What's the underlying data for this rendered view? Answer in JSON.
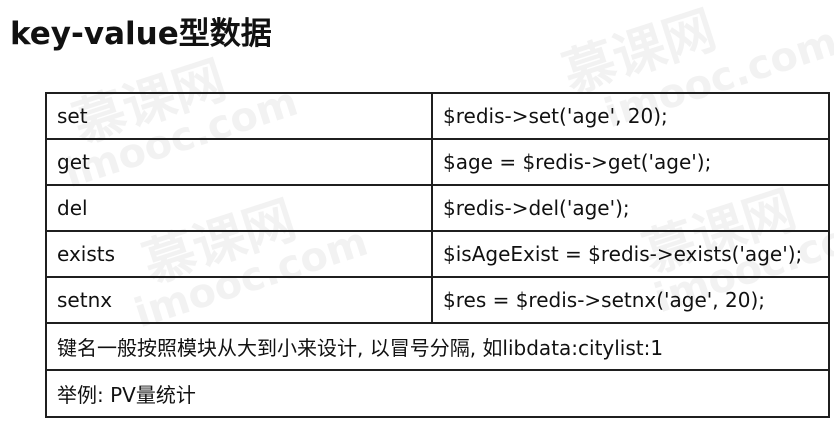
{
  "page": {
    "title": "key-value型数据"
  },
  "table": {
    "rows": [
      {
        "command": "set",
        "code": "$redis->set('age', 20);"
      },
      {
        "command": "get",
        "code": "$age = $redis->get('age');"
      },
      {
        "command": "del",
        "code": "$redis->del('age');"
      },
      {
        "command": "exists",
        "code": "$isAgeExist = $redis->exists('age');"
      },
      {
        "command": "setnx",
        "code": "$res = $redis->setnx('age', 20);"
      }
    ],
    "note": "键名一般按照模块从大到小来设计, 以冒号分隔, 如libdata:citylist:1",
    "example": "举例: PV量统计"
  },
  "watermark": {
    "text_top": "慕课网",
    "text_bottom": "imooc.com"
  }
}
